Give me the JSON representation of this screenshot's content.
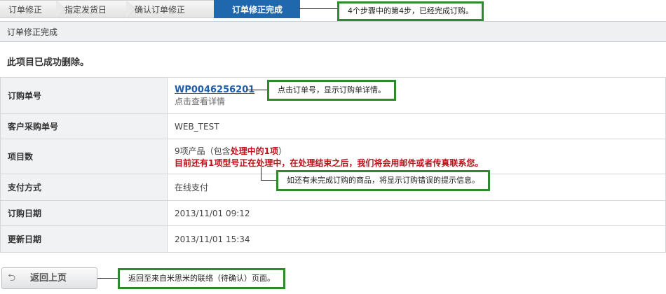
{
  "steps": [
    {
      "label": "订单修正"
    },
    {
      "label": "指定发货日"
    },
    {
      "label": "确认订单修正"
    },
    {
      "label": "订单修正完成"
    }
  ],
  "section": {
    "title": "订单修正完成"
  },
  "message": "此项目已成功删除。",
  "rows": {
    "order_no": {
      "label": "订购单号",
      "value": "WP0046256201",
      "sub": "点击查看详情"
    },
    "customer_po": {
      "label": "客户采购单号",
      "value": "WEB_TEST"
    },
    "items": {
      "label": "项目数",
      "value_prefix": "9项产品（包含",
      "value_processing": "处理中的1项",
      "value_suffix": "）",
      "warning": "目前还有1项型号正在处理中，在处理结束之后，我们将会用邮件或者传真联系您。"
    },
    "payment": {
      "label": "支付方式",
      "value": "在线支付"
    },
    "order_date": {
      "label": "订购日期",
      "value": "2013/11/01 09:12"
    },
    "update_date": {
      "label": "更新日期",
      "value": "2013/11/01 15:34"
    }
  },
  "back_button": {
    "label": "返回上页",
    "icon": "return-arrow-icon"
  },
  "callouts": {
    "step": "4个步骤中的第4步，已经完成订购。",
    "order": "点击订单号，显示订购单详情。",
    "error": "如还有未完成订购的商品，将显示订购错误的提示信息。",
    "back": "返回至来自米思米的联络（待确认）页面。"
  },
  "colors": {
    "active_step": "#1f68ad",
    "callout_border": "#2f8a2f",
    "warning": "#c0101a",
    "link": "#1f5ea8"
  }
}
